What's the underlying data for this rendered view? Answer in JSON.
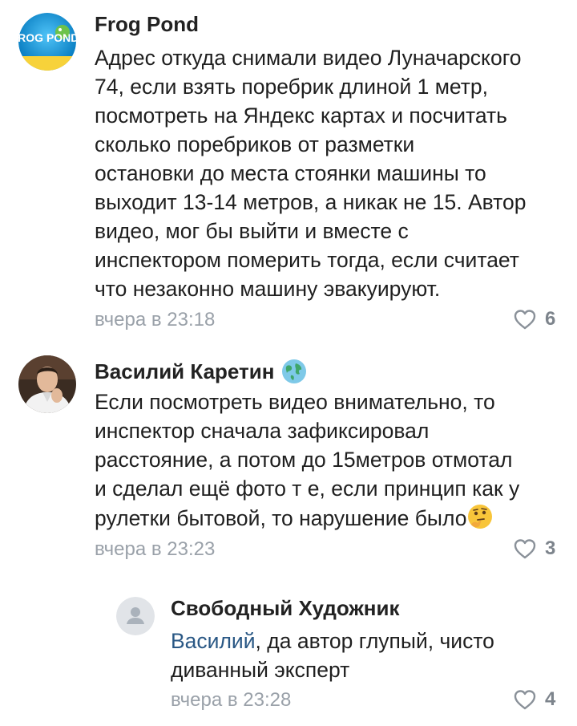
{
  "comments": [
    {
      "author": "Frog Pond",
      "avatar_text": "FROG POND",
      "lines": [
        "Адрес откуда снимали видео Луначарского",
        "74, если взять поребрик длиной 1 метр,",
        "посмотреть на Яндекс картах и посчитать",
        "сколько поребриков от разметки",
        "остановки до места стоянки машины то",
        "выходит 13-14 метров, а никак не 15. Автор",
        "видео, мог бы выйти и вместе с",
        "инспектором померить тогда, если считает",
        "что незаконно машину эвакуируют."
      ],
      "time": "вчера в 23:18",
      "likes": "6"
    },
    {
      "author": "Василий Каретин",
      "author_badge_icon": "globe-icon",
      "lines": [
        "Если посмотреть видео внимательно, то",
        "инспектор сначала зафиксировал",
        "расстояние, а потом до 15метров отмотал",
        "и сделал ещё фото т е, если принцип как у",
        "рулетки бытовой, то нарушение было"
      ],
      "emoji": "thinking-face-icon",
      "time": "вчера в 23:23",
      "likes": "3"
    },
    {
      "author": "Свободный Художник",
      "mention": "Василий",
      "line1_rest": ", да автор глупый, чисто",
      "line2": "диванный эксперт",
      "time": "вчера в 23:28",
      "likes": "4"
    }
  ],
  "colors": {
    "text": "#1f1f1f",
    "meta": "#9aa1a9",
    "mention": "#2a5885"
  }
}
